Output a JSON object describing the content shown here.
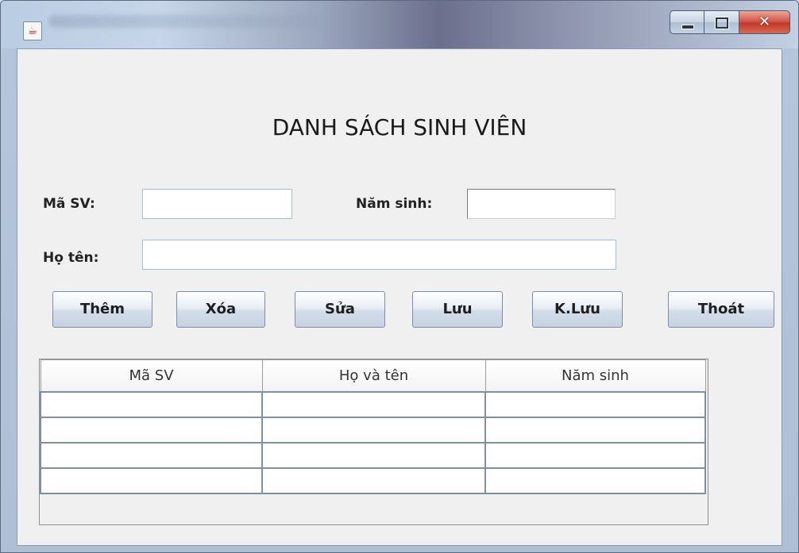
{
  "window": {
    "app_icon": "java-icon",
    "controls": [
      "minimize-icon",
      "maximize-icon",
      "close-icon"
    ]
  },
  "form": {
    "title": "DANH SÁCH SINH VIÊN",
    "ma_sv_label": "Mã SV:",
    "ma_sv_value": "",
    "nam_sinh_label": "Năm sinh:",
    "nam_sinh_value": "",
    "ho_ten_label": "Họ tên:",
    "ho_ten_value": ""
  },
  "buttons": {
    "them": "Thêm",
    "xoa": "Xóa",
    "sua": "Sửa",
    "luu": "Lưu",
    "k_luu": "K.Lưu",
    "thoat": "Thoát"
  },
  "table": {
    "columns": [
      "Mã SV",
      "Họ và tên",
      "Năm sinh"
    ],
    "rows": [
      [
        "",
        "",
        ""
      ],
      [
        "",
        "",
        ""
      ],
      [
        "",
        "",
        ""
      ],
      [
        "",
        "",
        ""
      ]
    ]
  },
  "colors": {
    "panel_bg": "#f0f0f0",
    "field_border": "#a9bdd6",
    "close_button": "#c0392b"
  }
}
